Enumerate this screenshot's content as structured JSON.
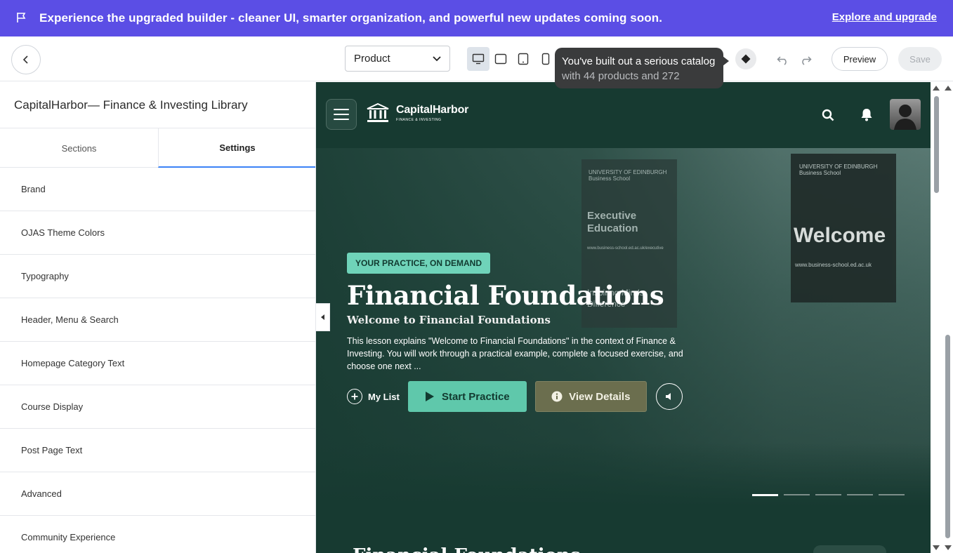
{
  "banner": {
    "text": "Experience the upgraded builder - cleaner UI, smarter organization, and powerful new updates coming soon.",
    "link": "Explore and upgrade",
    "icon": "flag-icon"
  },
  "toolbar": {
    "select_value": "Product",
    "devices": [
      "desktop-icon",
      "tablet-landscape-icon",
      "tablet-portrait-icon",
      "mobile-icon"
    ],
    "tooltip_line1": "You've built out a serious catalog",
    "tooltip_line2": "with 44 products and 272",
    "preview_label": "Preview",
    "save_label": "Save"
  },
  "sidebar": {
    "title": "CapitalHarbor— Finance & Investing Library",
    "tabs": [
      {
        "label": "Sections"
      },
      {
        "label": "Settings"
      }
    ],
    "items": [
      {
        "label": "Brand"
      },
      {
        "label": "OJAS Theme Colors"
      },
      {
        "label": "Typography"
      },
      {
        "label": "Header, Menu & Search"
      },
      {
        "label": "Homepage Category Text"
      },
      {
        "label": "Course Display"
      },
      {
        "label": "Post Page Text"
      },
      {
        "label": "Advanced"
      },
      {
        "label": "Community Experience"
      }
    ]
  },
  "site": {
    "logo_name": "CapitalHarbor",
    "logo_sub": "FINANCE & INVESTING"
  },
  "hero": {
    "bg_banner1_small": "UNIVERSITY OF EDINBURGH Business School",
    "bg_banner1_head": "Executive Education",
    "bg_banner1_url": "www.business-school.ed.ac.uk/executive",
    "bg_banner1_foot": "Inspiring Minds Difference",
    "bg_banner2_small": "UNIVERSITY OF EDINBURGH Business School",
    "bg_banner2_welcome": "Welcome",
    "bg_banner2_url": "www.business-school.ed.ac.uk",
    "eyebrow": "YOUR PRACTICE, ON DEMAND",
    "title": "Financial Foundations",
    "subtitle": "Welcome to Financial Foundations",
    "description": "This lesson explains \"Welcome to Financial Foundations\" in the context of Finance & Investing. You will work through a practical example, complete a focused exercise, and choose one next ...",
    "mylist_label": "My List",
    "start_label": "Start Practice",
    "details_label": "View Details",
    "slide_count": 5,
    "active_slide": 1
  },
  "next_section": {
    "title_peek": "Financial Foundations"
  },
  "colors": {
    "banner": "#5b4ee5",
    "site_bg": "#173a31",
    "accent": "#5fc8ab",
    "tab_active": "#3b82f6"
  }
}
